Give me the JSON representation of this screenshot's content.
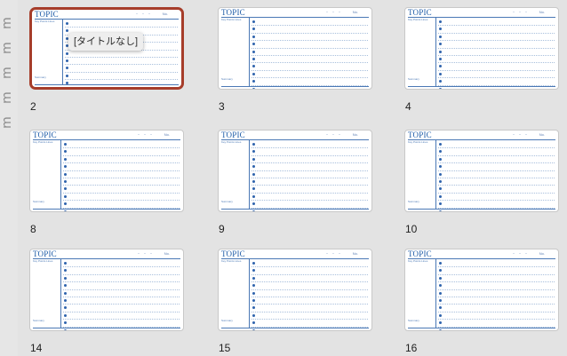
{
  "sidebar": {
    "glyphs": [
      "m",
      "m",
      "m",
      "m",
      "m"
    ]
  },
  "tooltip": {
    "text": "[タイトルなし]"
  },
  "pages": [
    {
      "number": "2",
      "selected": true
    },
    {
      "number": "3"
    },
    {
      "number": "4"
    },
    {
      "number": "8"
    },
    {
      "number": "9"
    },
    {
      "number": "10"
    },
    {
      "number": "14"
    },
    {
      "number": "15"
    },
    {
      "number": "16"
    }
  ],
  "template": {
    "topic": "TOPIC",
    "date_marks": "・・・",
    "no_mark": "No.",
    "side_note": "Key Points Lines",
    "side_footer": "Summary",
    "line_count": 11
  },
  "colors": {
    "selected_border": "#a63d2a",
    "topic_blue": "#1c5aa6",
    "bullet_blue": "#2f63ad",
    "background": "#e3e3e3"
  }
}
